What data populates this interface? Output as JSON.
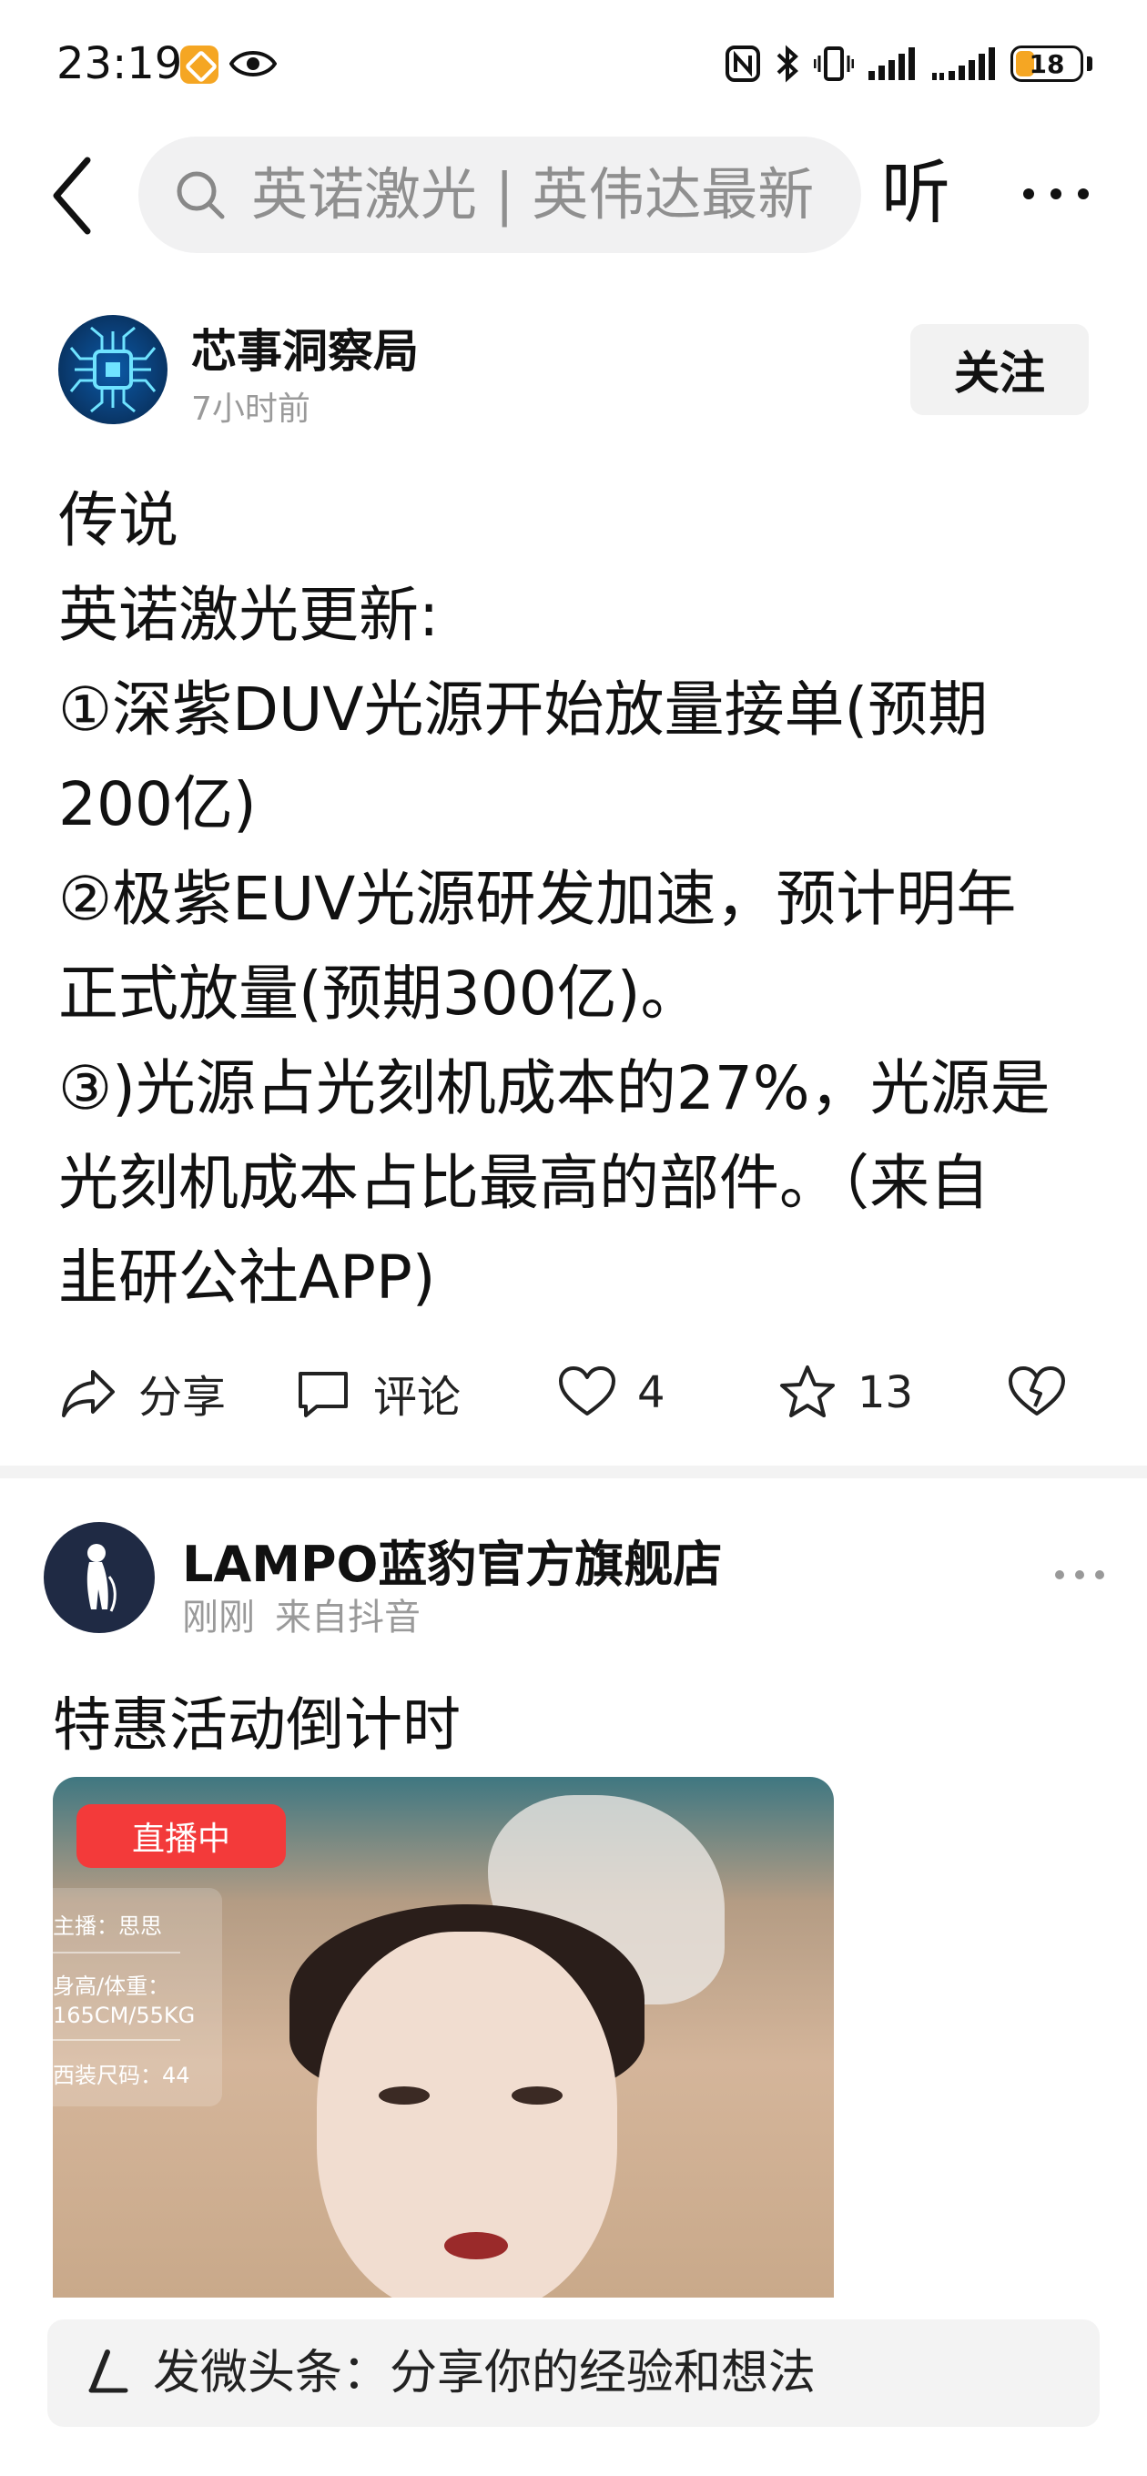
{
  "status_bar": {
    "time": "23:19",
    "battery_level": "18",
    "icons": [
      "app-badge-icon",
      "eye-icon",
      "nfc-icon",
      "bluetooth-icon",
      "vibrate-icon",
      "signal-icon",
      "signal-icon",
      "battery-icon"
    ]
  },
  "search": {
    "text": "英诺激光 | 英伟达最新",
    "listen_label": "听"
  },
  "post1": {
    "author": "芯事洞察局",
    "time": "7小时前",
    "follow_label": "关注",
    "lines": [
      "传说",
      "英诺激光更新:",
      "①深紫DUV光源开始放量接单(预期",
      "200亿)",
      "②极紫EUV光源研发加速，预计明年",
      "正式放量(预期300亿)。",
      "③)光源占光刻机成本的27%，光源是",
      "光刻机成本占比最高的部件。（来自",
      "韭研公社APP)"
    ],
    "actions": {
      "share": "分享",
      "comment": "评论",
      "likes": "4",
      "favorites": "13"
    }
  },
  "post2": {
    "author": "LAMPO蓝豹官方旗舰店",
    "meta_time": "刚刚",
    "meta_source": "来自抖音",
    "title": "特惠活动倒计时",
    "video": {
      "live_badge": "直播中",
      "info": [
        "主播：思思",
        "身高/体重：",
        "165CM/55KG",
        "西装尺码：44"
      ]
    }
  },
  "composer": {
    "placeholder": "发微头条：分享你的经验和想法"
  },
  "colors": {
    "accent_orange": "#f5a623",
    "live_red": "#f33a3a",
    "muted_text": "#9a9a9a"
  }
}
